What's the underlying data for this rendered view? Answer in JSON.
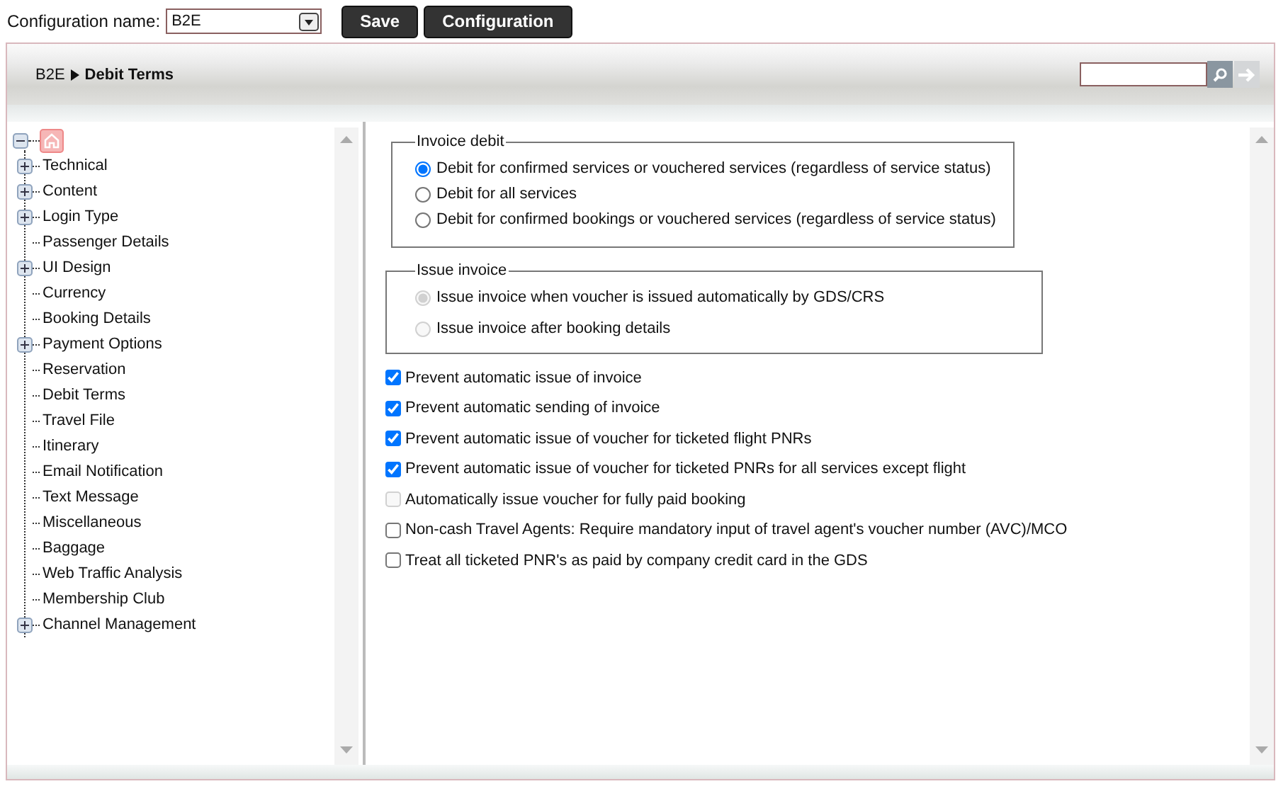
{
  "config": {
    "label": "Configuration name:",
    "value": "B2E"
  },
  "buttons": [
    "Save",
    "Configuration"
  ],
  "breadcrumb": {
    "root": "B2E",
    "current": "Debit Terms"
  },
  "tree": {
    "expanded": true,
    "children": [
      {
        "label": "Technical",
        "kind": "branch"
      },
      {
        "label": "Content",
        "kind": "branch"
      },
      {
        "label": "Login Type",
        "kind": "branch"
      },
      {
        "label": "Passenger Details",
        "kind": "leaf"
      },
      {
        "label": "UI Design",
        "kind": "branch"
      },
      {
        "label": "Currency",
        "kind": "leaf"
      },
      {
        "label": "Booking Details",
        "kind": "leaf"
      },
      {
        "label": "Payment Options",
        "kind": "branch"
      },
      {
        "label": "Reservation",
        "kind": "leaf"
      },
      {
        "label": "Debit Terms",
        "kind": "leaf"
      },
      {
        "label": "Travel File",
        "kind": "leaf"
      },
      {
        "label": "Itinerary",
        "kind": "leaf"
      },
      {
        "label": "Email Notification",
        "kind": "leaf"
      },
      {
        "label": "Text Message",
        "kind": "leaf"
      },
      {
        "label": "Miscellaneous",
        "kind": "leaf"
      },
      {
        "label": "Baggage",
        "kind": "leaf"
      },
      {
        "label": "Web Traffic Analysis",
        "kind": "leaf"
      },
      {
        "label": "Membership Club",
        "kind": "leaf"
      },
      {
        "label": "Channel Management",
        "kind": "branch"
      }
    ]
  },
  "groups": [
    {
      "title": "Invoice debit",
      "options": [
        {
          "label": "Debit for confirmed services or vouchered services (regardless of service status)",
          "selected": true,
          "disabled": false
        },
        {
          "label": "Debit for all services",
          "selected": false,
          "disabled": false
        },
        {
          "label": "Debit for confirmed bookings or vouchered services (regardless of service status)",
          "selected": false,
          "disabled": false
        }
      ]
    },
    {
      "title": "Issue invoice",
      "options": [
        {
          "label": "Issue invoice when voucher is issued automatically by GDS/CRS",
          "selected": true,
          "disabled": true
        },
        {
          "label": "Issue invoice after booking details",
          "selected": false,
          "disabled": true
        }
      ]
    }
  ],
  "checkboxes": [
    {
      "label": "Prevent automatic issue of invoice",
      "checked": true,
      "disabled": false
    },
    {
      "label": "Prevent automatic sending of invoice",
      "checked": true,
      "disabled": false
    },
    {
      "label": "Prevent automatic issue of voucher for ticketed flight PNRs",
      "checked": true,
      "disabled": false
    },
    {
      "label": "Prevent automatic issue of voucher for ticketed PNRs for all services except flight",
      "checked": true,
      "disabled": false
    },
    {
      "label": "Automatically issue voucher for fully paid booking",
      "checked": false,
      "disabled": true
    },
    {
      "label": "Non-cash Travel Agents: Require mandatory input of travel agent's voucher number (AVC)/MCO",
      "checked": false,
      "disabled": false
    },
    {
      "label": "Treat all ticketed PNR's as paid by company credit card in the GDS",
      "checked": false,
      "disabled": false
    }
  ]
}
